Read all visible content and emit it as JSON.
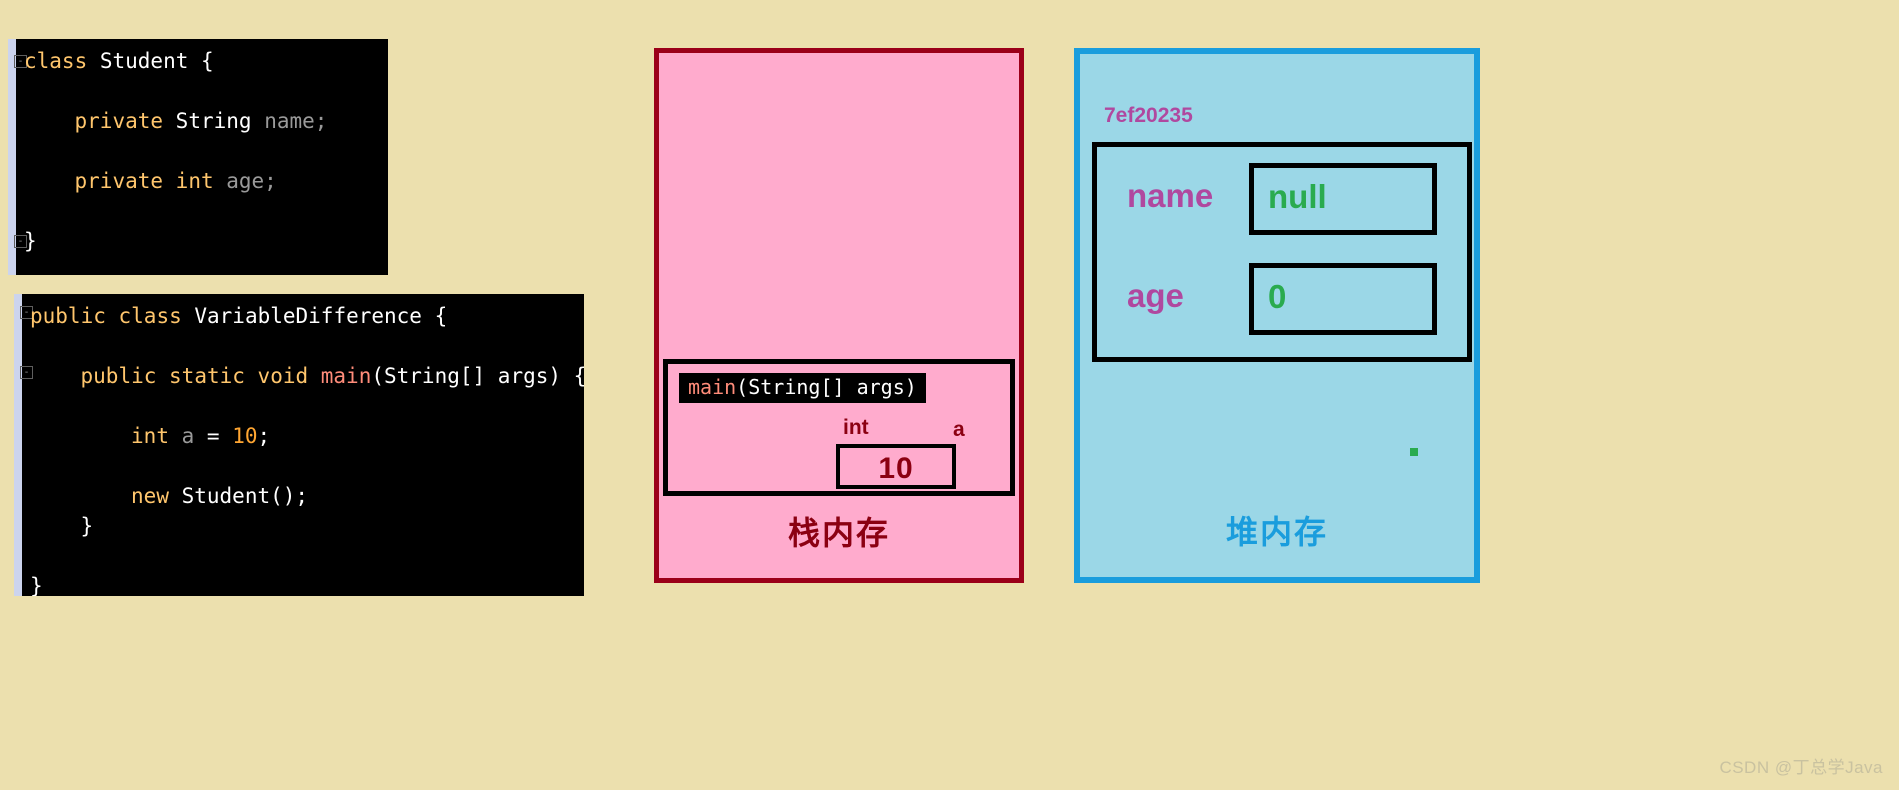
{
  "background_color": "#ece0ae",
  "code_blocks": [
    {
      "id": "student",
      "lines": [
        {
          "indent": 0,
          "tokens": [
            {
              "t": "class ",
              "c": "kw"
            },
            {
              "t": "Student ",
              "c": "typ"
            },
            {
              "t": "{",
              "c": "pun"
            }
          ]
        },
        {
          "indent": 0,
          "tokens": []
        },
        {
          "indent": 4,
          "tokens": [
            {
              "t": "private ",
              "c": "kw"
            },
            {
              "t": "String ",
              "c": "typ"
            },
            {
              "t": "name;",
              "c": "id"
            }
          ]
        },
        {
          "indent": 0,
          "tokens": []
        },
        {
          "indent": 4,
          "tokens": [
            {
              "t": "private ",
              "c": "kw"
            },
            {
              "t": "int ",
              "c": "kw"
            },
            {
              "t": "age;",
              "c": "id"
            }
          ]
        },
        {
          "indent": 0,
          "tokens": []
        },
        {
          "indent": 0,
          "tokens": [
            {
              "t": "}",
              "c": "pun"
            }
          ]
        }
      ]
    },
    {
      "id": "variable-difference",
      "lines": [
        {
          "indent": 0,
          "tokens": [
            {
              "t": "public ",
              "c": "kw"
            },
            {
              "t": "class ",
              "c": "kw"
            },
            {
              "t": "VariableDifference ",
              "c": "typ"
            },
            {
              "t": "{",
              "c": "pun"
            }
          ]
        },
        {
          "indent": 0,
          "tokens": []
        },
        {
          "indent": 4,
          "tokens": [
            {
              "t": "public ",
              "c": "kw"
            },
            {
              "t": "static ",
              "c": "kw"
            },
            {
              "t": "void ",
              "c": "kw"
            },
            {
              "t": "main",
              "c": "mth"
            },
            {
              "t": "(",
              "c": "pun"
            },
            {
              "t": "String",
              "c": "typ"
            },
            {
              "t": "[] ",
              "c": "pun"
            },
            {
              "t": "args",
              "c": "typ"
            },
            {
              "t": ") {",
              "c": "pun"
            }
          ]
        },
        {
          "indent": 0,
          "tokens": []
        },
        {
          "indent": 8,
          "tokens": [
            {
              "t": "int ",
              "c": "kw"
            },
            {
              "t": "a ",
              "c": "id"
            },
            {
              "t": "= ",
              "c": "pun"
            },
            {
              "t": "10",
              "c": "num"
            },
            {
              "t": ";",
              "c": "pun"
            }
          ]
        },
        {
          "indent": 0,
          "tokens": []
        },
        {
          "indent": 8,
          "tokens": [
            {
              "t": "new ",
              "c": "kw"
            },
            {
              "t": "Student();",
              "c": "typ"
            }
          ]
        },
        {
          "indent": 4,
          "tokens": [
            {
              "t": "}",
              "c": "pun"
            }
          ]
        },
        {
          "indent": 0,
          "tokens": []
        },
        {
          "indent": 0,
          "tokens": [
            {
              "t": "}",
              "c": "pun"
            }
          ]
        }
      ]
    }
  ],
  "stack": {
    "label": "栈内存",
    "border_color": "#9b0019",
    "fill_color": "#ffabcd",
    "text_color": "#8b0012",
    "frame": {
      "title_parts": [
        {
          "t": "main",
          "c": "mth"
        },
        {
          "t": "(",
          "c": "pun"
        },
        {
          "t": "String",
          "c": "typ"
        },
        {
          "t": "[] ",
          "c": "pun"
        },
        {
          "t": "args",
          "c": "typ"
        },
        {
          "t": ")",
          "c": "pun"
        }
      ],
      "title_plain": "main(String[] args)",
      "variable": {
        "type": "int",
        "name": "a",
        "value": "10"
      }
    }
  },
  "heap": {
    "label": "堆内存",
    "border_color": "#1a9ddd",
    "fill_color": "#9bd7e7",
    "address": "7ef20235",
    "address_color": "#b0489f",
    "value_color": "#2aab4f",
    "fields": [
      {
        "name": "name",
        "value": "null"
      },
      {
        "name": "age",
        "value": "0"
      }
    ]
  },
  "watermark": {
    "text": "CSDN @丁总学Java"
  }
}
